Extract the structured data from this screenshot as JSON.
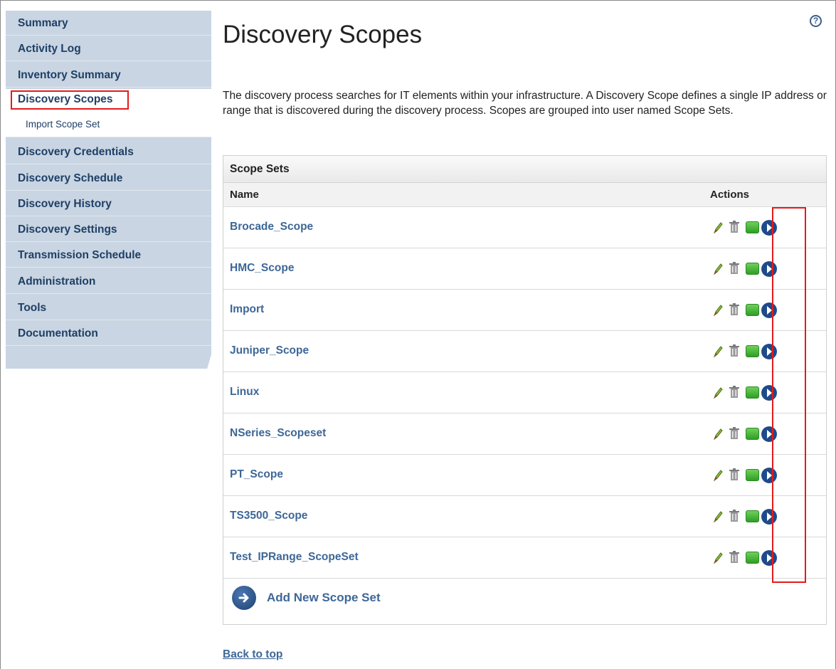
{
  "sidebar": {
    "items": [
      {
        "label": "Summary"
      },
      {
        "label": "Activity Log"
      },
      {
        "label": "Inventory Summary"
      },
      {
        "label": "Discovery Scopes"
      },
      {
        "label": "Import Scope Set"
      },
      {
        "label": "Discovery Credentials"
      },
      {
        "label": "Discovery Schedule"
      },
      {
        "label": "Discovery History"
      },
      {
        "label": "Discovery Settings"
      },
      {
        "label": "Transmission Schedule"
      },
      {
        "label": "Administration"
      },
      {
        "label": "Tools"
      },
      {
        "label": "Documentation"
      }
    ],
    "active": "Discovery Scopes"
  },
  "header": {
    "title": "Discovery Scopes",
    "help_icon": "?"
  },
  "intro": "The discovery process searches for IT elements within your infrastructure. A Discovery Scope defines a single IP address or range that is discovered during the discovery process. Scopes are grouped into user named Scope Sets.",
  "table": {
    "title": "Scope Sets",
    "columns": {
      "name": "Name",
      "actions": "Actions"
    },
    "rows": [
      {
        "name": "Brocade_Scope"
      },
      {
        "name": "HMC_Scope"
      },
      {
        "name": "Import"
      },
      {
        "name": "Juniper_Scope"
      },
      {
        "name": "Linux"
      },
      {
        "name": "NSeries_Scopeset"
      },
      {
        "name": "PT_Scope"
      },
      {
        "name": "TS3500_Scope"
      },
      {
        "name": "Test_IPRange_ScopeSet"
      }
    ],
    "add_label": "Add New Scope Set"
  },
  "footer": {
    "back_to_top": "Back to top"
  },
  "colors": {
    "link": "#3d6797",
    "sidebar_bg": "#c9d5e2",
    "highlight": "#e31b1b"
  },
  "icons": {
    "row_actions": [
      "pencil-edit-icon",
      "trash-delete-icon",
      "green-square-icon",
      "go-arrow-icon"
    ],
    "add": "add-arrow-icon",
    "help": "help-question-icon"
  }
}
